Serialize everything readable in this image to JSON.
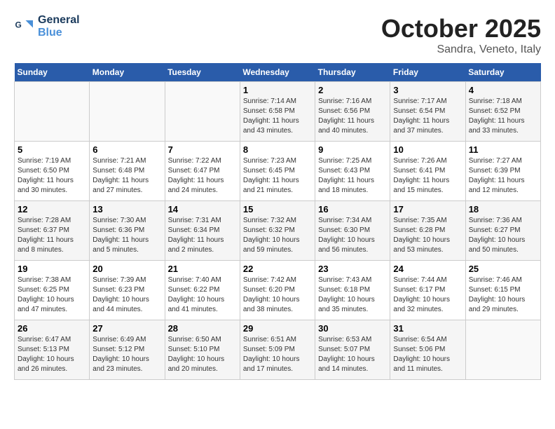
{
  "header": {
    "logo_line1": "General",
    "logo_line2": "Blue",
    "month": "October 2025",
    "location": "Sandra, Veneto, Italy"
  },
  "weekdays": [
    "Sunday",
    "Monday",
    "Tuesday",
    "Wednesday",
    "Thursday",
    "Friday",
    "Saturday"
  ],
  "weeks": [
    [
      {
        "day": "",
        "info": ""
      },
      {
        "day": "",
        "info": ""
      },
      {
        "day": "",
        "info": ""
      },
      {
        "day": "1",
        "info": "Sunrise: 7:14 AM\nSunset: 6:58 PM\nDaylight: 11 hours and 43 minutes."
      },
      {
        "day": "2",
        "info": "Sunrise: 7:16 AM\nSunset: 6:56 PM\nDaylight: 11 hours and 40 minutes."
      },
      {
        "day": "3",
        "info": "Sunrise: 7:17 AM\nSunset: 6:54 PM\nDaylight: 11 hours and 37 minutes."
      },
      {
        "day": "4",
        "info": "Sunrise: 7:18 AM\nSunset: 6:52 PM\nDaylight: 11 hours and 33 minutes."
      }
    ],
    [
      {
        "day": "5",
        "info": "Sunrise: 7:19 AM\nSunset: 6:50 PM\nDaylight: 11 hours and 30 minutes."
      },
      {
        "day": "6",
        "info": "Sunrise: 7:21 AM\nSunset: 6:48 PM\nDaylight: 11 hours and 27 minutes."
      },
      {
        "day": "7",
        "info": "Sunrise: 7:22 AM\nSunset: 6:47 PM\nDaylight: 11 hours and 24 minutes."
      },
      {
        "day": "8",
        "info": "Sunrise: 7:23 AM\nSunset: 6:45 PM\nDaylight: 11 hours and 21 minutes."
      },
      {
        "day": "9",
        "info": "Sunrise: 7:25 AM\nSunset: 6:43 PM\nDaylight: 11 hours and 18 minutes."
      },
      {
        "day": "10",
        "info": "Sunrise: 7:26 AM\nSunset: 6:41 PM\nDaylight: 11 hours and 15 minutes."
      },
      {
        "day": "11",
        "info": "Sunrise: 7:27 AM\nSunset: 6:39 PM\nDaylight: 11 hours and 12 minutes."
      }
    ],
    [
      {
        "day": "12",
        "info": "Sunrise: 7:28 AM\nSunset: 6:37 PM\nDaylight: 11 hours and 8 minutes."
      },
      {
        "day": "13",
        "info": "Sunrise: 7:30 AM\nSunset: 6:36 PM\nDaylight: 11 hours and 5 minutes."
      },
      {
        "day": "14",
        "info": "Sunrise: 7:31 AM\nSunset: 6:34 PM\nDaylight: 11 hours and 2 minutes."
      },
      {
        "day": "15",
        "info": "Sunrise: 7:32 AM\nSunset: 6:32 PM\nDaylight: 10 hours and 59 minutes."
      },
      {
        "day": "16",
        "info": "Sunrise: 7:34 AM\nSunset: 6:30 PM\nDaylight: 10 hours and 56 minutes."
      },
      {
        "day": "17",
        "info": "Sunrise: 7:35 AM\nSunset: 6:28 PM\nDaylight: 10 hours and 53 minutes."
      },
      {
        "day": "18",
        "info": "Sunrise: 7:36 AM\nSunset: 6:27 PM\nDaylight: 10 hours and 50 minutes."
      }
    ],
    [
      {
        "day": "19",
        "info": "Sunrise: 7:38 AM\nSunset: 6:25 PM\nDaylight: 10 hours and 47 minutes."
      },
      {
        "day": "20",
        "info": "Sunrise: 7:39 AM\nSunset: 6:23 PM\nDaylight: 10 hours and 44 minutes."
      },
      {
        "day": "21",
        "info": "Sunrise: 7:40 AM\nSunset: 6:22 PM\nDaylight: 10 hours and 41 minutes."
      },
      {
        "day": "22",
        "info": "Sunrise: 7:42 AM\nSunset: 6:20 PM\nDaylight: 10 hours and 38 minutes."
      },
      {
        "day": "23",
        "info": "Sunrise: 7:43 AM\nSunset: 6:18 PM\nDaylight: 10 hours and 35 minutes."
      },
      {
        "day": "24",
        "info": "Sunrise: 7:44 AM\nSunset: 6:17 PM\nDaylight: 10 hours and 32 minutes."
      },
      {
        "day": "25",
        "info": "Sunrise: 7:46 AM\nSunset: 6:15 PM\nDaylight: 10 hours and 29 minutes."
      }
    ],
    [
      {
        "day": "26",
        "info": "Sunrise: 6:47 AM\nSunset: 5:13 PM\nDaylight: 10 hours and 26 minutes."
      },
      {
        "day": "27",
        "info": "Sunrise: 6:49 AM\nSunset: 5:12 PM\nDaylight: 10 hours and 23 minutes."
      },
      {
        "day": "28",
        "info": "Sunrise: 6:50 AM\nSunset: 5:10 PM\nDaylight: 10 hours and 20 minutes."
      },
      {
        "day": "29",
        "info": "Sunrise: 6:51 AM\nSunset: 5:09 PM\nDaylight: 10 hours and 17 minutes."
      },
      {
        "day": "30",
        "info": "Sunrise: 6:53 AM\nSunset: 5:07 PM\nDaylight: 10 hours and 14 minutes."
      },
      {
        "day": "31",
        "info": "Sunrise: 6:54 AM\nSunset: 5:06 PM\nDaylight: 10 hours and 11 minutes."
      },
      {
        "day": "",
        "info": ""
      }
    ]
  ]
}
